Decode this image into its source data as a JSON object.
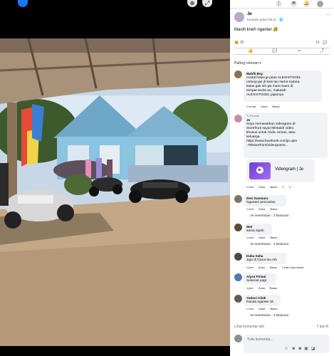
{
  "post": {
    "author": "Je",
    "timestamp": "Kemarin pukul 09.11 · 🌐",
    "caption": "Masih kneh nganter 🤣",
    "reactions_count": "95",
    "comments_count": "14",
    "sort_label": "Paling relevan ▾"
  },
  "comments": [
    {
      "author": "Mahfii Boy",
      "text": "modal halus jp paus ALEXISTOGEL\nuntung gw di kasi tau sama sodara,\nkalau gak sih gw masi maen di\ntempat sedot wc, makasih\nALEXISTOGEL jajannya",
      "time": "1 menit",
      "like": "Suka",
      "reply": "Balas"
    },
    {
      "badge": "✎ Penulis",
      "author": "Je",
      "text": "Saya menawarkan videogram di\nStorefront saya! Mintalah video\nkhusus untuk Anda, teman, atau\nkeluarga.\nhttps://www.facebook.com/je.ujen\n.79/storefront/videograms...",
      "link_title": "Videogram | Je",
      "time": "1 hari",
      "like": "Suka",
      "reply": "Balas",
      "reactions": "2"
    },
    {
      "author": "Devi Dasmara",
      "text": "Nganteri pencairan",
      "time": "1 hari",
      "like": "Suka",
      "reply": "Balas",
      "replies": "Je membalas · 2 Balasan"
    },
    {
      "author": "Wat",
      "text": "sama sipah",
      "time": "1 hari",
      "like": "Suka",
      "reply": "Balas",
      "replies": "Je membalas · 2 Balasan"
    },
    {
      "author": "Duka Saha",
      "text": "Jiga di Garut ieu mh",
      "time": "1 jam",
      "like": "Suka",
      "reply": "Balas",
      "extra": "Lihat terjemahan"
    },
    {
      "author": "Alysa Ftriani",
      "text": "Selamat pagi",
      "time": "1 jam",
      "like": "Suka",
      "reply": "Balas"
    },
    {
      "author": "Yadoci Cilok",
      "text": "Randa nganter sh",
      "time": "1 hari",
      "like": "Suka",
      "reply": "Balas",
      "replies": "Je membalas · 2 Balasan"
    }
  ],
  "more_comments": "Lihat komentar lain",
  "comment_count_label": "7 dari 8",
  "composer_placeholder": "Tulis komentar...",
  "colors": {
    "accent": "#1877f2",
    "bubble": "#f0f2f5",
    "muted": "#65676b"
  }
}
